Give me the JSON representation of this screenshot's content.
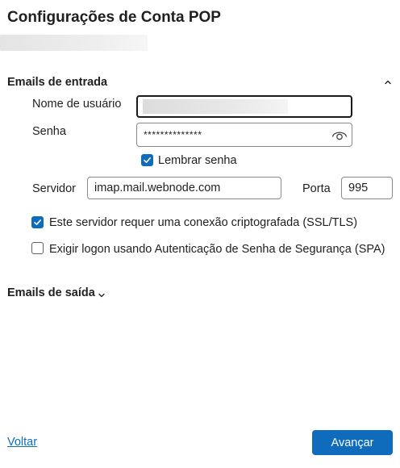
{
  "page": {
    "title": "Configurações de Conta POP"
  },
  "incoming": {
    "section_title": "Emails de entrada",
    "username_label": "Nome de usuário",
    "password_label": "Senha",
    "password_value": "**************",
    "remember_password_label": "Lembrar senha",
    "remember_password_checked": true,
    "server_label": "Servidor",
    "server_value": "imap.mail.webnode.com",
    "port_label": "Porta",
    "port_value": "995",
    "ssl_label": "Este servidor requer uma conexão criptografada (SSL/TLS)",
    "ssl_checked": true,
    "spa_label": "Exigir logon usando Autenticação de Senha de Segurança (SPA)",
    "spa_checked": false
  },
  "outgoing": {
    "section_title": "Emails de saída"
  },
  "footer": {
    "back_label": "Voltar",
    "next_label": "Avançar"
  },
  "colors": {
    "accent": "#0f6cbd",
    "text": "#1f1f1f"
  },
  "icons": {
    "collapse": "chevron-up-icon",
    "expand": "chevron-down-icon",
    "reveal_password": "eye-icon",
    "checkmark": "checkmark-icon"
  }
}
